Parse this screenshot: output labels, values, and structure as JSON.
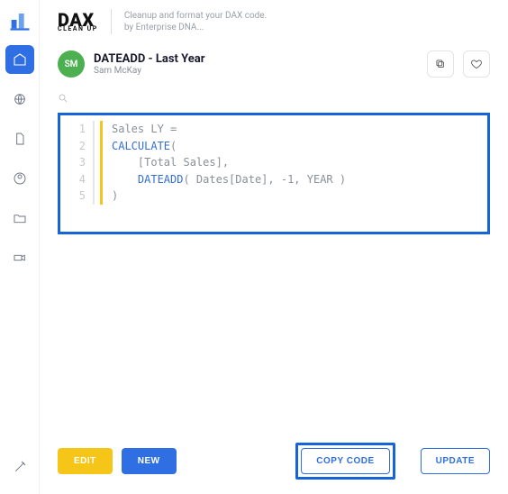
{
  "brand": {
    "name": "DAX",
    "sub": "CLEAN UP"
  },
  "tagline": {
    "line1": "Cleanup and format your DAX code.",
    "line2": "by Enterprise DNA..."
  },
  "card": {
    "title": "DATEADD - Last Year",
    "author": "Sam McKay",
    "avatar_initials": "SM"
  },
  "editor": {
    "line_numbers": [
      "1",
      "2",
      "3",
      "4",
      "5"
    ],
    "l1_a": "Sales LY =",
    "l2_a": "CALCULATE",
    "l2_b": "(",
    "l3_a": "    [Total Sales],",
    "l4_a": "    ",
    "l4_b": "DATEADD",
    "l4_c": "( Dates[Date], -1, YEAR )",
    "l5_a": ")"
  },
  "buttons": {
    "edit": "EDIT",
    "new": "NEW",
    "copy": "COPY CODE",
    "update": "UPDATE"
  },
  "colors": {
    "accent": "#2f6fe3",
    "highlight_border": "#1565d8",
    "warn": "#f5c518",
    "avatar": "#4caf50"
  }
}
